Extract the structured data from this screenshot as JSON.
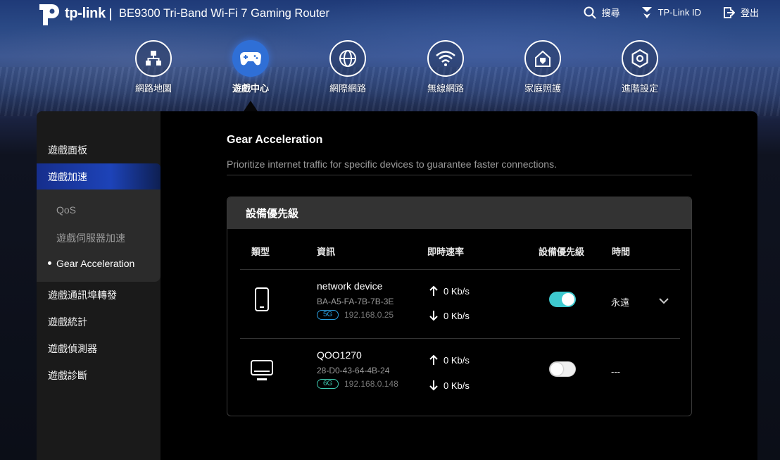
{
  "header": {
    "brand": "tp-link",
    "model": "BE9300 Tri-Band Wi-Fi 7 Gaming Router",
    "actions": [
      {
        "label": "搜尋",
        "icon": "search-icon"
      },
      {
        "label": "TP-Link ID",
        "icon": "tplink-id-icon"
      },
      {
        "label": "登出",
        "icon": "logout-icon"
      }
    ]
  },
  "nav": [
    {
      "label": "網路地圖",
      "icon": "network-map-icon"
    },
    {
      "label": "遊戲中心",
      "icon": "gamepad-icon",
      "active": true
    },
    {
      "label": "網際網路",
      "icon": "globe-icon"
    },
    {
      "label": "無線網路",
      "icon": "wifi-icon"
    },
    {
      "label": "家庭照護",
      "icon": "home-shield-icon"
    },
    {
      "label": "進階設定",
      "icon": "gear-icon"
    }
  ],
  "sidebar": {
    "items": [
      {
        "label": "遊戲面板"
      },
      {
        "label": "遊戲加速",
        "active": true
      },
      {
        "label": "遊戲通訊埠轉發"
      },
      {
        "label": "遊戲統計"
      },
      {
        "label": "遊戲偵測器"
      },
      {
        "label": "遊戲診斷"
      }
    ],
    "sub_items": [
      {
        "label": "QoS"
      },
      {
        "label": "遊戲伺服器加速"
      },
      {
        "label": "Gear Acceleration",
        "active": true
      }
    ]
  },
  "content": {
    "title": "Gear Acceleration",
    "description": "Prioritize internet traffic for specific devices to guarantee faster connections.",
    "card": {
      "title": "設備優先級",
      "columns": [
        "類型",
        "資訊",
        "即時速率",
        "設備優先級",
        "時間"
      ],
      "rows": [
        {
          "type_icon": "phone-icon",
          "name": "network device",
          "mac": "BA-A5-FA-7B-7B-3E",
          "band": "5G",
          "ip": "192.168.0.25",
          "up": "0 Kb/s",
          "down": "0 Kb/s",
          "priority": true,
          "time": "永遠"
        },
        {
          "type_icon": "monitor-icon",
          "name": "QOO1270",
          "mac": "28-D0-43-64-4B-24",
          "band": "6G",
          "ip": "192.168.0.148",
          "up": "0 Kb/s",
          "down": "0 Kb/s",
          "priority": false,
          "time": "---"
        }
      ]
    }
  },
  "colors": {
    "accent": "#2f6fd6",
    "toggle_on": "#3ec9cf",
    "band_5g": "#2a9fe0",
    "band_6g": "#3ec9b0"
  }
}
